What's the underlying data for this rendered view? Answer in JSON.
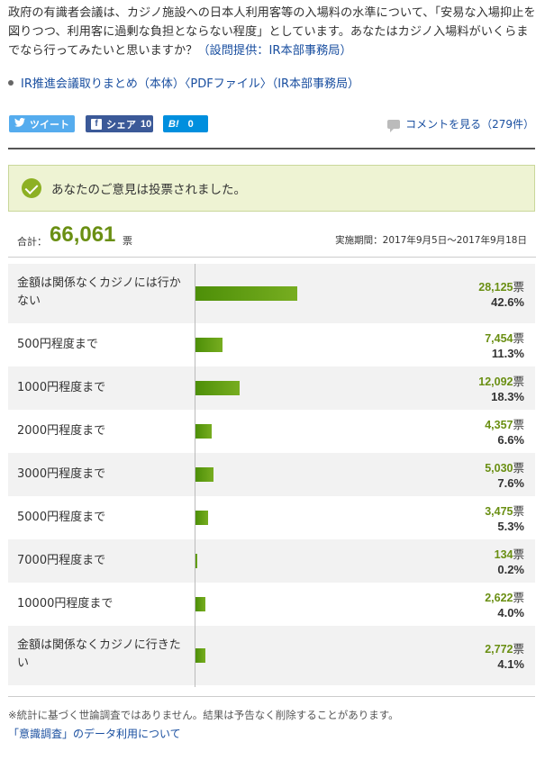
{
  "question": {
    "text": "政府の有識者会議は、カジノ施設への日本人利用客等の入場料の水準について、「安易な入場抑止を図りつつ、利用客に過剰な負担とならない程度」としています。あなたはカジノ入場料がいくらまでなら行ってみたいと思いますか？",
    "source": "（設問提供：IR本部事務局）"
  },
  "doc_link": "IR推進会議取りまとめ（本体）〈PDFファイル〉（IR本部事務局）",
  "share": {
    "tweet_label": "ツイート",
    "facebook_label": "シェア",
    "facebook_count": "10",
    "hatena_label": "B!",
    "hatena_count": "0"
  },
  "comments_link": "コメントを見る（279件）",
  "voted_message": "あなたのご意見は投票されました。",
  "summary": {
    "total_label": "合計：",
    "total": "66,061",
    "unit": "票",
    "period": "実施期間：2017年9月5日〜2017年9月18日"
  },
  "chart_data": {
    "type": "bar",
    "categories": [
      "金額は関係なくカジノには行かない",
      "500円程度まで",
      "1000円程度まで",
      "2000円程度まで",
      "3000円程度まで",
      "5000円程度まで",
      "7000円程度まで",
      "10000円程度まで",
      "金額は関係なくカジノに行きたい"
    ],
    "values": [
      28125,
      7454,
      12092,
      4357,
      5030,
      3475,
      134,
      2622,
      2772
    ],
    "vote_labels": [
      "28,125",
      "7,454",
      "12,092",
      "4,357",
      "5,030",
      "3,475",
      "134",
      "2,622",
      "2,772"
    ],
    "percent_labels": [
      "42.6%",
      "11.3%",
      "18.3%",
      "6.6%",
      "7.6%",
      "5.3%",
      "0.2%",
      "4.0%",
      "4.1%"
    ],
    "vote_unit": "票",
    "bar_color": "#5f9c10"
  },
  "footer": {
    "note": "※統計に基づく世論調査ではありません。結果は予告なく削除することがあります。",
    "data_link": "「意識調査」のデータ利用について"
  }
}
